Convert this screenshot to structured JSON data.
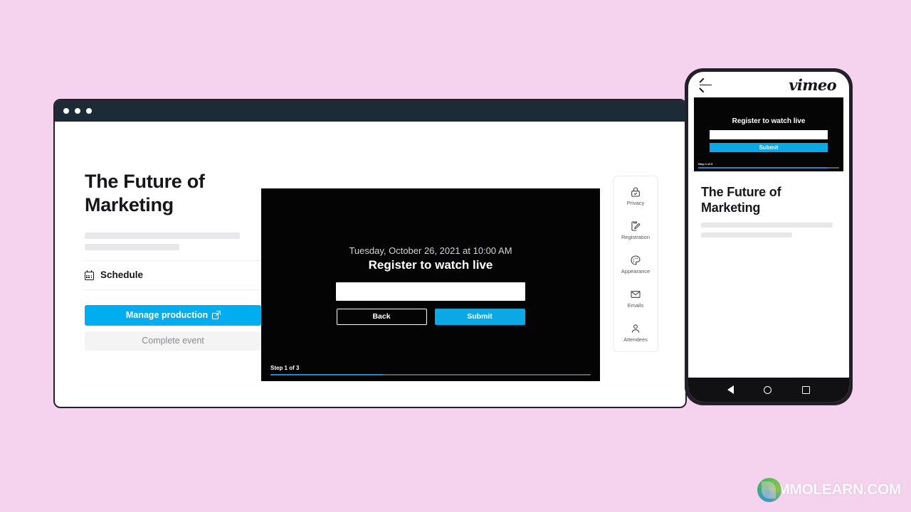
{
  "background_color": "#f5d2ee",
  "accent_color": "#00adee",
  "browser": {
    "titlebar": {
      "color": "#1d2b36",
      "dots": 3
    },
    "left_panel": {
      "event_title": "The Future of\nMarketing",
      "schedule_label": "Schedule",
      "schedule_icon": "calendar-icon",
      "primary_button": {
        "label": "Manage production",
        "icon": "external-link-icon",
        "color": "#00adee"
      },
      "secondary_button": {
        "label": "Complete event",
        "color": "#f4f4f5",
        "text_color": "#8b8b92"
      }
    },
    "player": {
      "date": "Tuesday, October 26, 2021 at 10:00 AM",
      "heading": "Register to watch live",
      "input_value": "",
      "input_placeholder": "",
      "back_label": "Back",
      "submit_label": "Submit",
      "step_text": "Step 1 of 3",
      "progress_percent": 35
    },
    "rail": {
      "items": [
        {
          "label": "Privacy",
          "icon": "lock-check-icon"
        },
        {
          "label": "Registration",
          "icon": "clipboard-pencil-icon"
        },
        {
          "label": "Appearance",
          "icon": "palette-icon"
        },
        {
          "label": "Emails",
          "icon": "envelope-icon"
        },
        {
          "label": "Attendees",
          "icon": "person-icon"
        }
      ]
    }
  },
  "phone": {
    "back_icon": "back-arrow-icon",
    "brand": "vimeo",
    "player": {
      "heading": "Register to watch live",
      "input_value": "",
      "submit_label": "Submit",
      "step_text": "Step 1 of 3",
      "progress_percent": 92
    },
    "event_title": "The Future of\nMarketing",
    "nav": {
      "back": "nav-back-icon",
      "home": "nav-home-icon",
      "recent": "nav-recents-icon"
    }
  },
  "watermark": {
    "text": "MMOLEARN.COM",
    "logo": "mmolearn-logo-icon"
  }
}
